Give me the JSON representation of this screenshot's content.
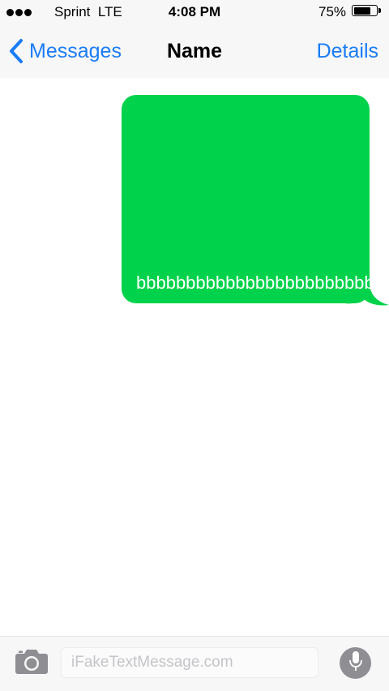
{
  "status_bar": {
    "carrier": "Sprint  LTE",
    "time": "4:08 PM",
    "battery_percent": "75%",
    "battery_level": 0.75,
    "signal_icon": "signal-dots-icon",
    "battery_icon": "battery-icon"
  },
  "nav": {
    "back_label": "Messages",
    "back_icon": "chevron-left-icon",
    "title": "Name",
    "details_label": "Details"
  },
  "messages": [
    {
      "direction": "outgoing",
      "text": "bbbbbbbbbbbbbbbbbbbbbbbbb"
    }
  ],
  "input_bar": {
    "camera_icon": "camera-icon",
    "placeholder": "iFakeTextMessage.com",
    "mic_icon": "microphone-icon"
  },
  "colors": {
    "accent": "#1a7cf6",
    "bubble": "#00d34b",
    "bar_background": "#f7f7f7",
    "mic_button": "#8e8e93"
  }
}
